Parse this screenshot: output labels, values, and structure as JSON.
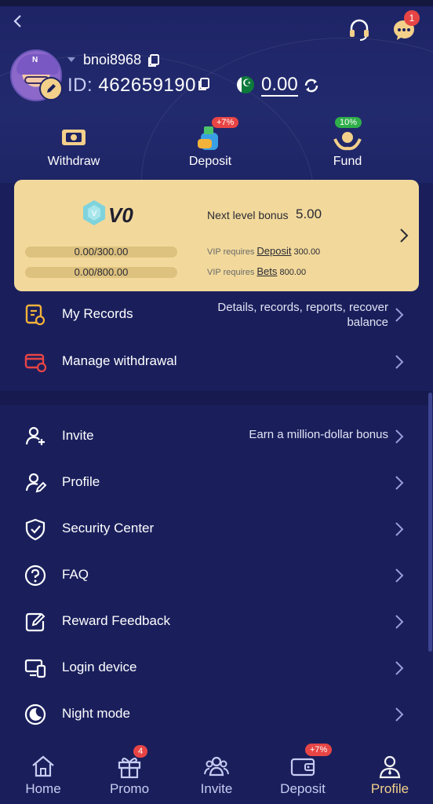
{
  "header": {
    "username": "bnoi8968",
    "id_label": "ID:",
    "id_value": "462659190",
    "balance": "0.00",
    "message_count": "1"
  },
  "quick_actions": [
    {
      "label": "Withdraw",
      "icon": "ticket-icon"
    },
    {
      "label": "Deposit",
      "icon": "money-bag-icon",
      "badge": "+7%"
    },
    {
      "label": "Fund",
      "icon": "hands-coin-icon",
      "badge": "10%"
    }
  ],
  "vip": {
    "level": "V0",
    "next_label": "Next level bonus",
    "next_value": "5.00",
    "deposit_progress": "0.00/300.00",
    "bets_progress": "0.00/800.00",
    "requires_label": "VIP requires",
    "deposit_link": "Deposit",
    "deposit_amount": "300.00",
    "bets_link": "Bets",
    "bets_amount": "800.00"
  },
  "section1": [
    {
      "label": "My Records",
      "hint_line1": "Details, records, reports, recover",
      "hint_line2": "balance",
      "icon": "records-icon"
    },
    {
      "label": "Manage withdrawal",
      "icon": "card-gear-icon"
    }
  ],
  "section2": [
    {
      "label": "Invite",
      "hint": "Earn a million-dollar bonus",
      "icon": "invite-user-icon"
    },
    {
      "label": "Profile",
      "icon": "profile-edit-icon"
    },
    {
      "label": "Security Center",
      "icon": "shield-check-icon"
    },
    {
      "label": "FAQ",
      "icon": "question-circle-icon"
    },
    {
      "label": "Reward Feedback",
      "icon": "feedback-edit-icon"
    },
    {
      "label": "Login device",
      "icon": "devices-icon"
    },
    {
      "label": "Night mode",
      "icon": "moon-icon"
    }
  ],
  "bottom_nav": [
    {
      "label": "Home",
      "icon": "home-icon"
    },
    {
      "label": "Promo",
      "icon": "gift-icon",
      "badge": "4"
    },
    {
      "label": "Invite",
      "icon": "group-icon"
    },
    {
      "label": "Deposit",
      "icon": "wallet-icon",
      "badge": "+7%"
    },
    {
      "label": "Profile",
      "icon": "person-icon",
      "active": true
    }
  ],
  "colors": {
    "background": "#1a1f5c",
    "vip_card": "#f2d99b",
    "accent_gold": "#f3d08a",
    "badge_red": "#e74545"
  }
}
